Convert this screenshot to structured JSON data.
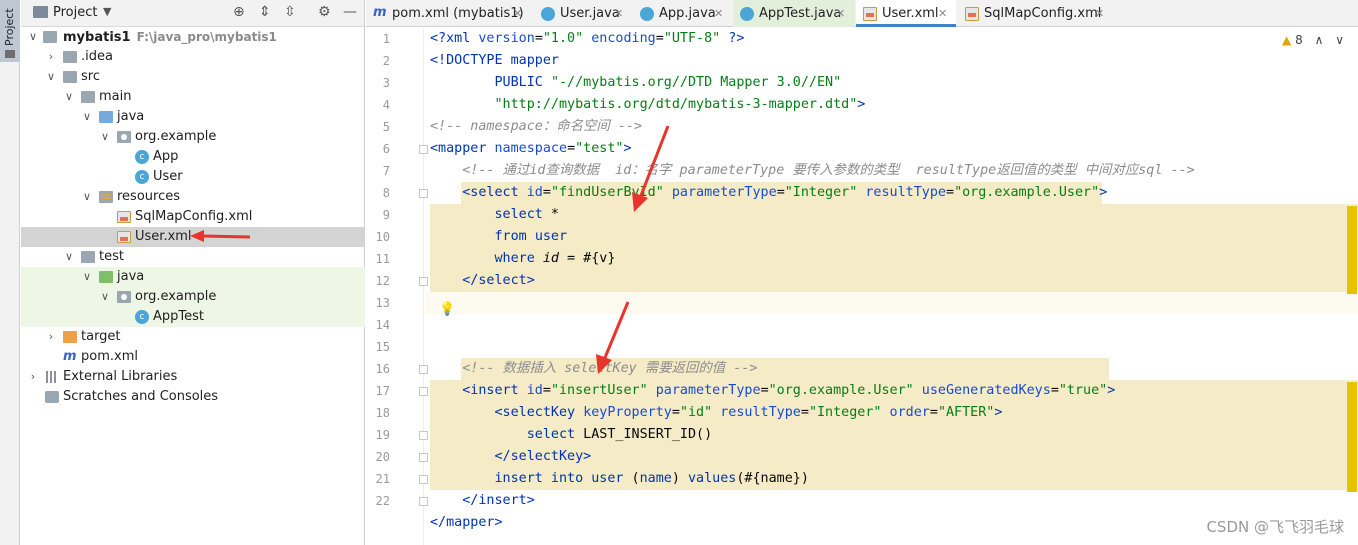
{
  "side_strip": {
    "project_tab": "Project"
  },
  "project_panel": {
    "title": "Project",
    "tree": [
      {
        "label": "mybatis1",
        "path": "F:\\java_pro\\mybatis1",
        "icon": "folder-icon",
        "bold": true
      },
      {
        "label": ".idea",
        "icon": "folder-icon"
      },
      {
        "label": "src",
        "icon": "folder-icon"
      },
      {
        "label": "main",
        "icon": "folder-icon"
      },
      {
        "label": "java",
        "icon": "source-folder-icon"
      },
      {
        "label": "org.example",
        "icon": "package-icon"
      },
      {
        "label": "App",
        "icon": "java-class-icon"
      },
      {
        "label": "User",
        "icon": "java-class-icon"
      },
      {
        "label": "resources",
        "icon": "resources-folder-icon"
      },
      {
        "label": "SqlMapConfig.xml",
        "icon": "xml-file-icon"
      },
      {
        "label": "User.xml",
        "icon": "xml-file-icon",
        "selected": true
      },
      {
        "label": "test",
        "icon": "folder-icon"
      },
      {
        "label": "java",
        "icon": "test-folder-icon"
      },
      {
        "label": "org.example",
        "icon": "package-icon"
      },
      {
        "label": "AppTest",
        "icon": "java-class-icon"
      },
      {
        "label": "target",
        "icon": "excluded-folder-icon"
      },
      {
        "label": "pom.xml",
        "icon": "maven-icon"
      },
      {
        "label": "External Libraries",
        "icon": "libraries-icon"
      },
      {
        "label": "Scratches and Consoles",
        "icon": "scratches-icon"
      }
    ]
  },
  "tabs": [
    {
      "label": "pom.xml (mybatis1)",
      "icon": "maven-icon"
    },
    {
      "label": "User.java",
      "icon": "java-class-icon"
    },
    {
      "label": "App.java",
      "icon": "java-class-icon"
    },
    {
      "label": "AppTest.java",
      "icon": "java-class-icon"
    },
    {
      "label": "User.xml",
      "icon": "xml-file-icon",
      "active": true
    },
    {
      "label": "SqlMapConfig.xml",
      "icon": "xml-file-icon"
    }
  ],
  "inspections": {
    "warnings": "8"
  },
  "line_numbers": [
    "1",
    "2",
    "3",
    "4",
    "5",
    "6",
    "7",
    "8",
    "9",
    "10",
    "11",
    "12",
    "13",
    "14",
    "15",
    "16",
    "17",
    "18",
    "19",
    "20",
    "21",
    "22"
  ],
  "code": {
    "l1": {
      "a": "<?",
      "b": "xml ",
      "c": "version",
      "d": "=",
      "e": "\"1.0\"",
      "f": " encoding",
      "g": "=",
      "h": "\"UTF-8\"",
      "i": " ?>"
    },
    "l2": {
      "a": "<!DOCTYPE mapper"
    },
    "l3": {
      "a": "        PUBLIC ",
      "b": "\"-//mybatis.org//DTD Mapper 3.0//EN\""
    },
    "l4": {
      "a": "        ",
      "b": "\"http://mybatis.org/dtd/mybatis-3-mapper.dtd\"",
      "c": ">"
    },
    "l5": {
      "a": "<!-- namespace：命名空间 -->"
    },
    "l6": {
      "a": "<mapper ",
      "b": "namespace",
      "c": "=",
      "d": "\"test\"",
      "e": ">"
    },
    "l7": {
      "a": "    <!-- 通过id查询数据  id：名字 parameterType 要传入参数的类型  resultType返回值的类型 中间对应sql -->"
    },
    "l8": {
      "a": "    <select ",
      "b": "id",
      "c": "=",
      "d": "\"findUserById\"",
      "e": " parameterType",
      "f": "=",
      "g": "\"Integer\"",
      "h": " resultType",
      "i": "=",
      "j": "\"org.example.User\"",
      "k": ">"
    },
    "l9": {
      "a": "        ",
      "b": "select",
      "c": " *"
    },
    "l10": {
      "a": "        ",
      "b": "from",
      "c": " ",
      "d": "user"
    },
    "l11": {
      "a": "        ",
      "b": "where",
      "c": " ",
      "d": "id",
      "e": " = #{v}"
    },
    "l12": {
      "a": "    </select>"
    },
    "l15": {
      "a": "    <!-- 数据插入 selectKey 需要返回的值 -->"
    },
    "l16": {
      "a": "    <insert ",
      "b": "id",
      "c": "=",
      "d": "\"insertUser\"",
      "e": " parameterType",
      "f": "=",
      "g": "\"org.example.User\"",
      "h": " useGeneratedKeys",
      "i": "=",
      "j": "\"true\"",
      "k": ">"
    },
    "l17": {
      "a": "        <selectKey ",
      "b": "keyProperty",
      "c": "=",
      "d": "\"id\"",
      "e": " resultType",
      "f": "=",
      "g": "\"Integer\"",
      "h": " order",
      "i": "=",
      "j": "\"AFTER\"",
      "k": ">"
    },
    "l18": {
      "a": "            ",
      "b": "select",
      "c": " LAST_INSERT_ID()"
    },
    "l19": {
      "a": "        </selectKey>"
    },
    "l20": {
      "a": "        ",
      "b": "insert into",
      "c": " ",
      "d": "user",
      "e": " (",
      "f": "name",
      "g": ") ",
      "h": "values",
      "i": "(#{name})"
    },
    "l21": {
      "a": "    </insert>"
    },
    "l22": {
      "a": "</mapper>"
    }
  },
  "watermark": "CSDN @飞飞羽毛球",
  "colors": {
    "tag": "#0033b3",
    "string": "#067d17",
    "comment": "#8c8c8c",
    "highlight": "#f5ebc6",
    "arrow": "#e8352b"
  }
}
